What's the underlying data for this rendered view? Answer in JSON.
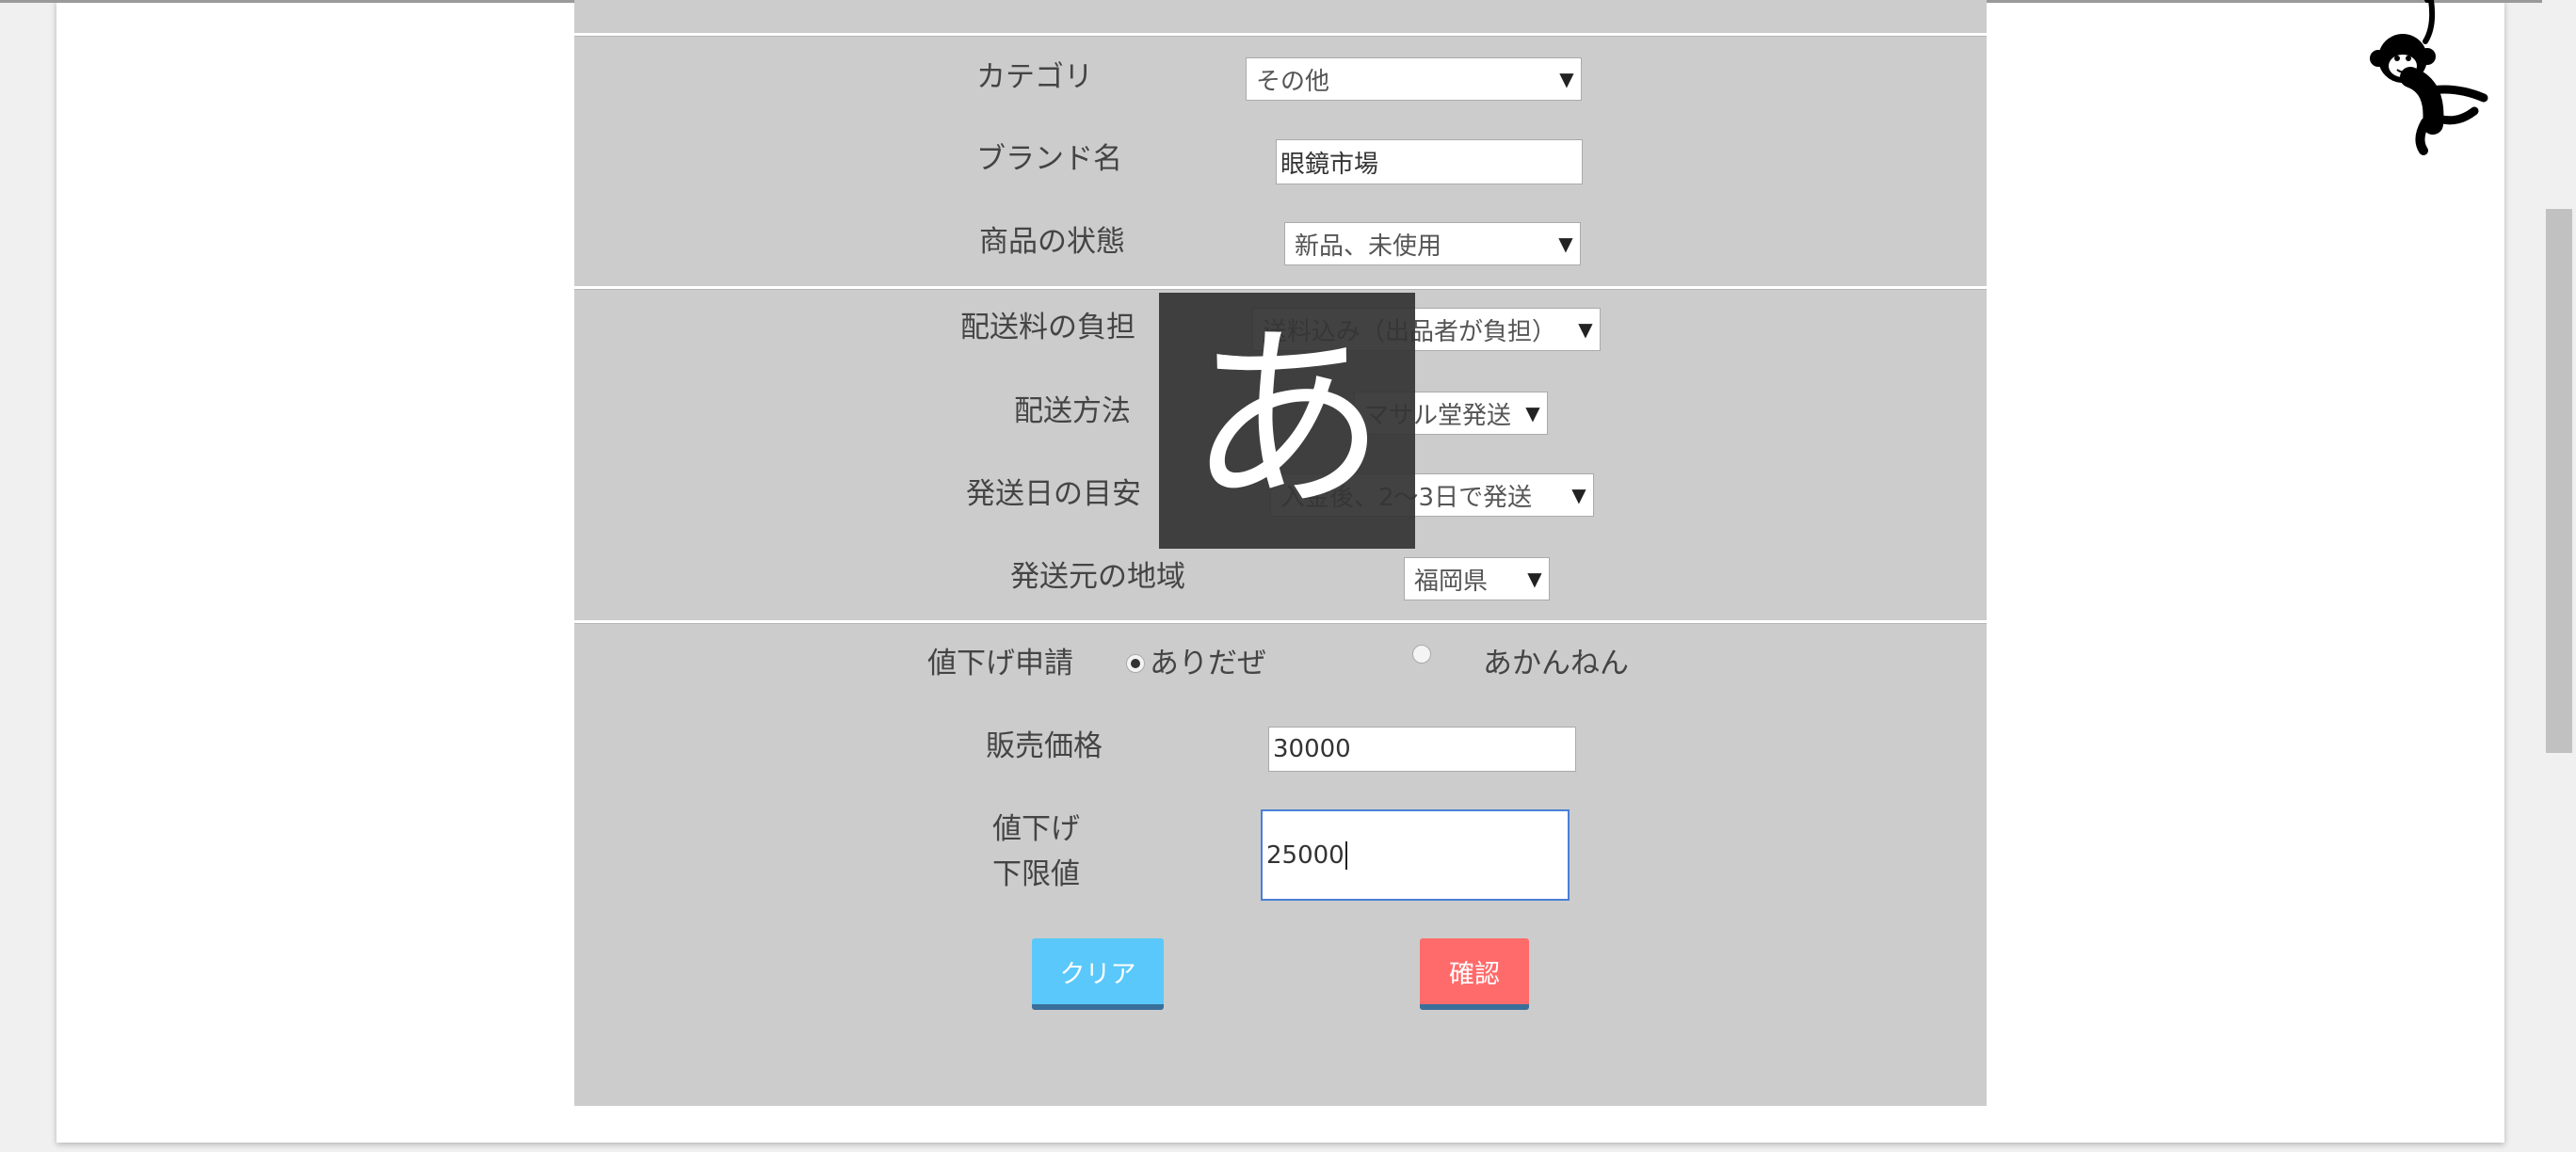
{
  "form": {
    "category": {
      "label": "カテゴリ",
      "value": "その他"
    },
    "brand": {
      "label": "ブランド名",
      "value": "眼鏡市場"
    },
    "condition": {
      "label": "商品の状態",
      "value": "新品、未使用"
    },
    "shipping_fee": {
      "label": "配送料の負担",
      "value": "送料込み（出品者が負担）"
    },
    "shipping_method": {
      "label": "配送方法",
      "value": "マサル堂発送"
    },
    "shipping_days": {
      "label": "発送日の目安",
      "value": "入金後、2〜3日で発送"
    },
    "origin": {
      "label": "発送元の地域",
      "value": "福岡県"
    },
    "price_request": {
      "label": "値下げ申請",
      "option_yes": "ありだぜ",
      "option_no": "あかんねん",
      "selected": "ありだぜ"
    },
    "price": {
      "label": "販売価格",
      "value": "30000"
    },
    "min_price": {
      "label_line1": "値下げ",
      "label_line2": "下限値",
      "value": "25000"
    },
    "clear_button": "クリア",
    "confirm_button": "確認"
  },
  "ime_indicator": "あ",
  "colors": {
    "form_bg": "#cccccc",
    "clear_button": "#5ac8fa",
    "confirm_button": "#ff6b6b",
    "focus_border": "#4a7fd8"
  },
  "icons": {
    "mascot": "hanging-monkey-icon",
    "select_arrow": "triangle-down"
  }
}
